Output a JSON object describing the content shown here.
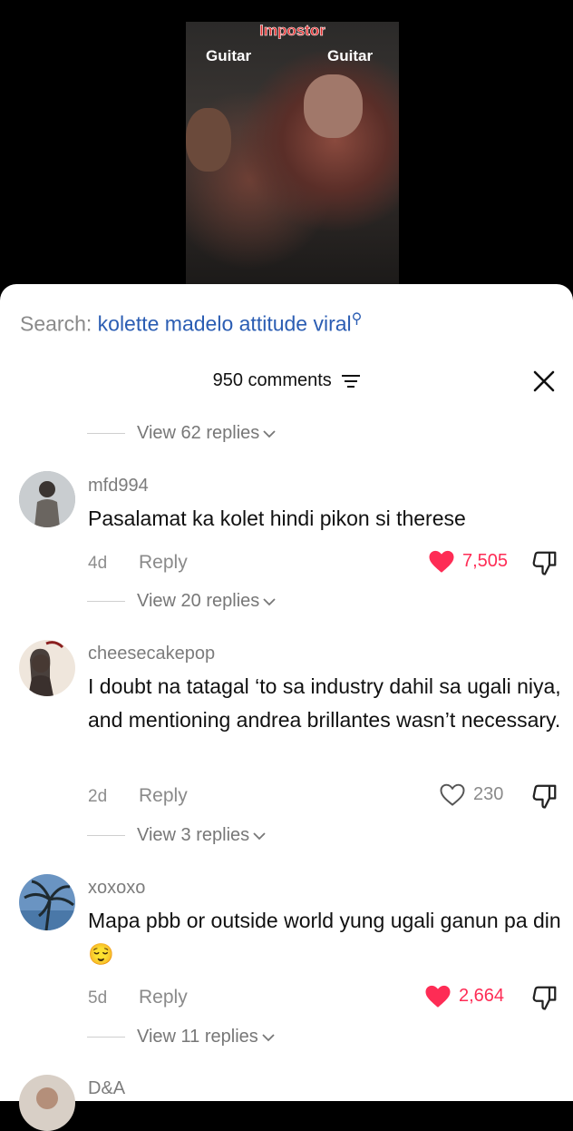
{
  "video": {
    "top_text": "Impostor",
    "label_left": "Guitar",
    "label_right": "Guitar"
  },
  "search": {
    "prefix": "Search:",
    "query": "kolette madelo attitude viral"
  },
  "header": {
    "title": "950 comments"
  },
  "top_view_replies": "View 62 replies",
  "comments": [
    {
      "username": "mfd994",
      "text": "Pasalamat ka kolet hindi pikon si therese",
      "age": "4d",
      "reply_label": "Reply",
      "likes": "7,505",
      "liked": true,
      "view_replies": "View 20 replies"
    },
    {
      "username": "cheesecakepop",
      "text": "I doubt na tatagal ‘to sa industry dahil sa ugali niya, and mentioning andrea brillantes wasn’t necessary.",
      "age": "2d",
      "reply_label": "Reply",
      "likes": "230",
      "liked": false,
      "view_replies": "View 3 replies"
    },
    {
      "username": "xoxoxo",
      "text": "Mapa pbb or outside world yung ugali ganun pa din 😌",
      "age": "5d",
      "reply_label": "Reply",
      "likes": "2,664",
      "liked": true,
      "view_replies": "View 11 replies"
    },
    {
      "username": "D&A"
    }
  ],
  "colors": {
    "like_red": "#fe2c55",
    "search_blue": "#2b5db3",
    "video_label_red": "#e12b2b"
  }
}
